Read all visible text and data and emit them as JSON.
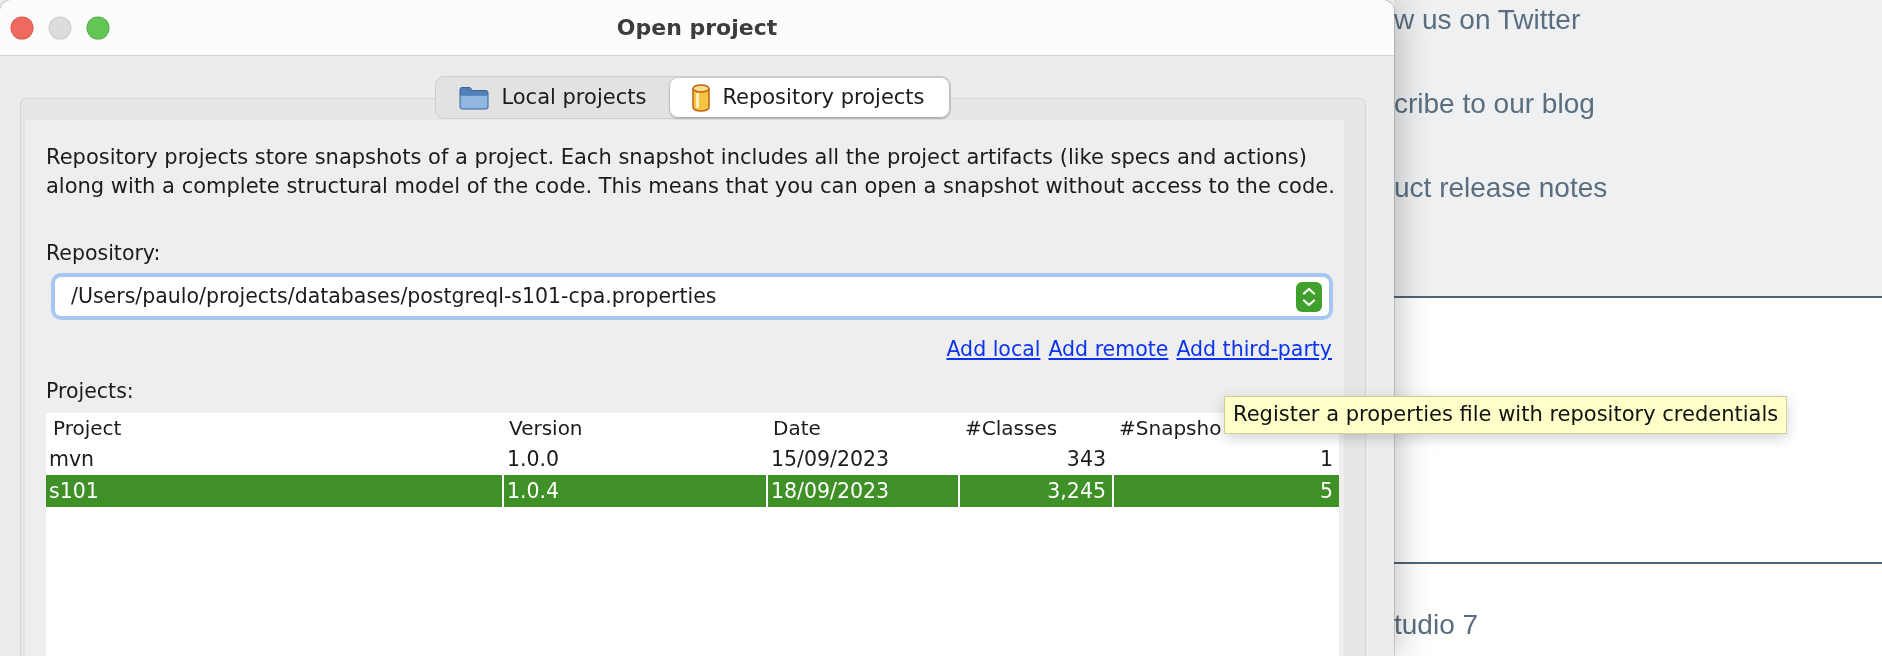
{
  "window": {
    "title": "Open project",
    "buttons": [
      {
        "kind": "close",
        "disabled": false
      },
      {
        "kind": "minimize",
        "disabled": true
      },
      {
        "kind": "zoom",
        "disabled": false
      }
    ]
  },
  "tabs": [
    {
      "label": "Local projects",
      "selected": false
    },
    {
      "label": "Repository projects",
      "selected": true
    }
  ],
  "description": "Repository projects store snapshots of a project. Each snapshot includes all the project artifacts (like specs and actions) along with a complete structural model of the code. This means that you can open a snapshot without access to the code.",
  "repository": {
    "label": "Repository:",
    "value": "/Users/paulo/projects/databases/postgreql-s101-cpa.properties"
  },
  "links": [
    "Add local",
    "Add remote",
    "Add third-party"
  ],
  "projects": {
    "label": "Projects:",
    "columns": [
      {
        "label": "Project",
        "kind": "text"
      },
      {
        "label": "Version",
        "kind": "text"
      },
      {
        "label": "Date",
        "kind": "text"
      },
      {
        "label": "#Classes",
        "kind": "number"
      },
      {
        "label": "#Snapsho",
        "kind": "number"
      }
    ],
    "rows": [
      {
        "cells": [
          "mvn",
          "1.0.0",
          "15/09/2023",
          "343",
          "1"
        ],
        "selected": false
      },
      {
        "cells": [
          "s101",
          "1.0.4",
          "18/09/2023",
          "3,245",
          "5"
        ],
        "selected": true
      }
    ]
  },
  "tooltip": {
    "text": "Register a properties file with repository credentials"
  },
  "background_page": {
    "links": [
      "w us on Twitter",
      "cribe to our blog",
      "uct release notes"
    ],
    "section_text": "tudio 7"
  }
}
